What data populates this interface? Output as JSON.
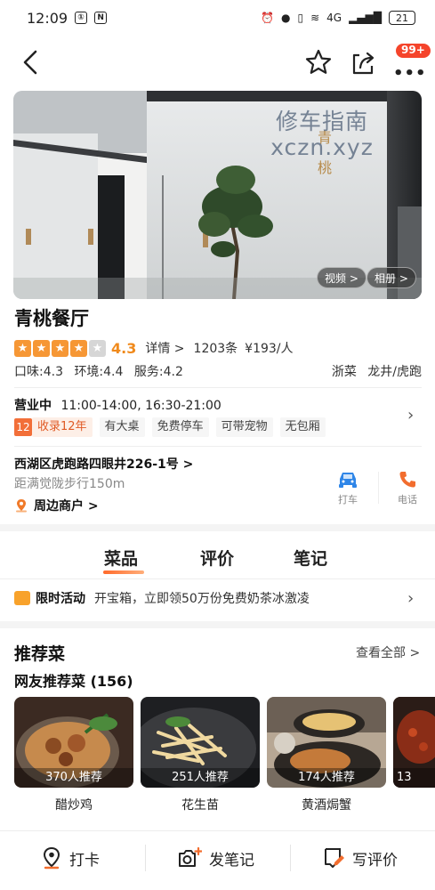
{
  "status_bar": {
    "time": "12:09",
    "icon_boxes": [
      "N"
    ],
    "network": "4G",
    "battery": "21"
  },
  "nav": {
    "badge": "99+",
    "icons": [
      "back-arrow-icon",
      "star-icon",
      "share-icon",
      "more-icon"
    ]
  },
  "hero": {
    "watermark_line1": "修车指南",
    "watermark_line2": "xczn.xyz",
    "video_chip": "视频 >",
    "album_chip": "相册 >"
  },
  "restaurant": {
    "name": "青桃餐厅",
    "rating": "4.3",
    "stars_filled": 4,
    "detail_link": "详情 >",
    "review_count": "1203条",
    "price": "¥193/人",
    "taste": "口味:4.3",
    "environment": "环境:4.4",
    "service": "服务:4.2",
    "cuisine": "浙菜",
    "area": "龙井/虎跑"
  },
  "hours": {
    "label": "营业中",
    "time": "11:00-14:00, 16:30-21:00",
    "years_icon": "12",
    "tags": [
      "收录12年",
      "有大桌",
      "免费停车",
      "可带宠物",
      "无包厢"
    ]
  },
  "location": {
    "address": "西湖区虎跑路四眼井226-1号 >",
    "distance": "距满觉陇步行150m",
    "nearby": "周边商户 >",
    "taxi_label": "打车",
    "phone_label": "电话"
  },
  "tabs": [
    "菜品",
    "评价",
    "笔记"
  ],
  "promo": {
    "label": "限时活动",
    "text": "开宝箱，立即领50万份免费奶茶冰激凌"
  },
  "recommend": {
    "title": "推荐菜",
    "see_all": "查看全部 >",
    "subtitle": "网友推荐菜 (156)",
    "dishes": [
      {
        "name": "醋炒鸡",
        "count": "370人推荐"
      },
      {
        "name": "花生苗",
        "count": "251人推荐"
      },
      {
        "name": "黄酒焗蟹",
        "count": "174人推荐"
      }
    ],
    "peek_count": "13"
  },
  "bottom_bar": {
    "checkin": "打卡",
    "note": "发笔记",
    "review": "写评价"
  }
}
